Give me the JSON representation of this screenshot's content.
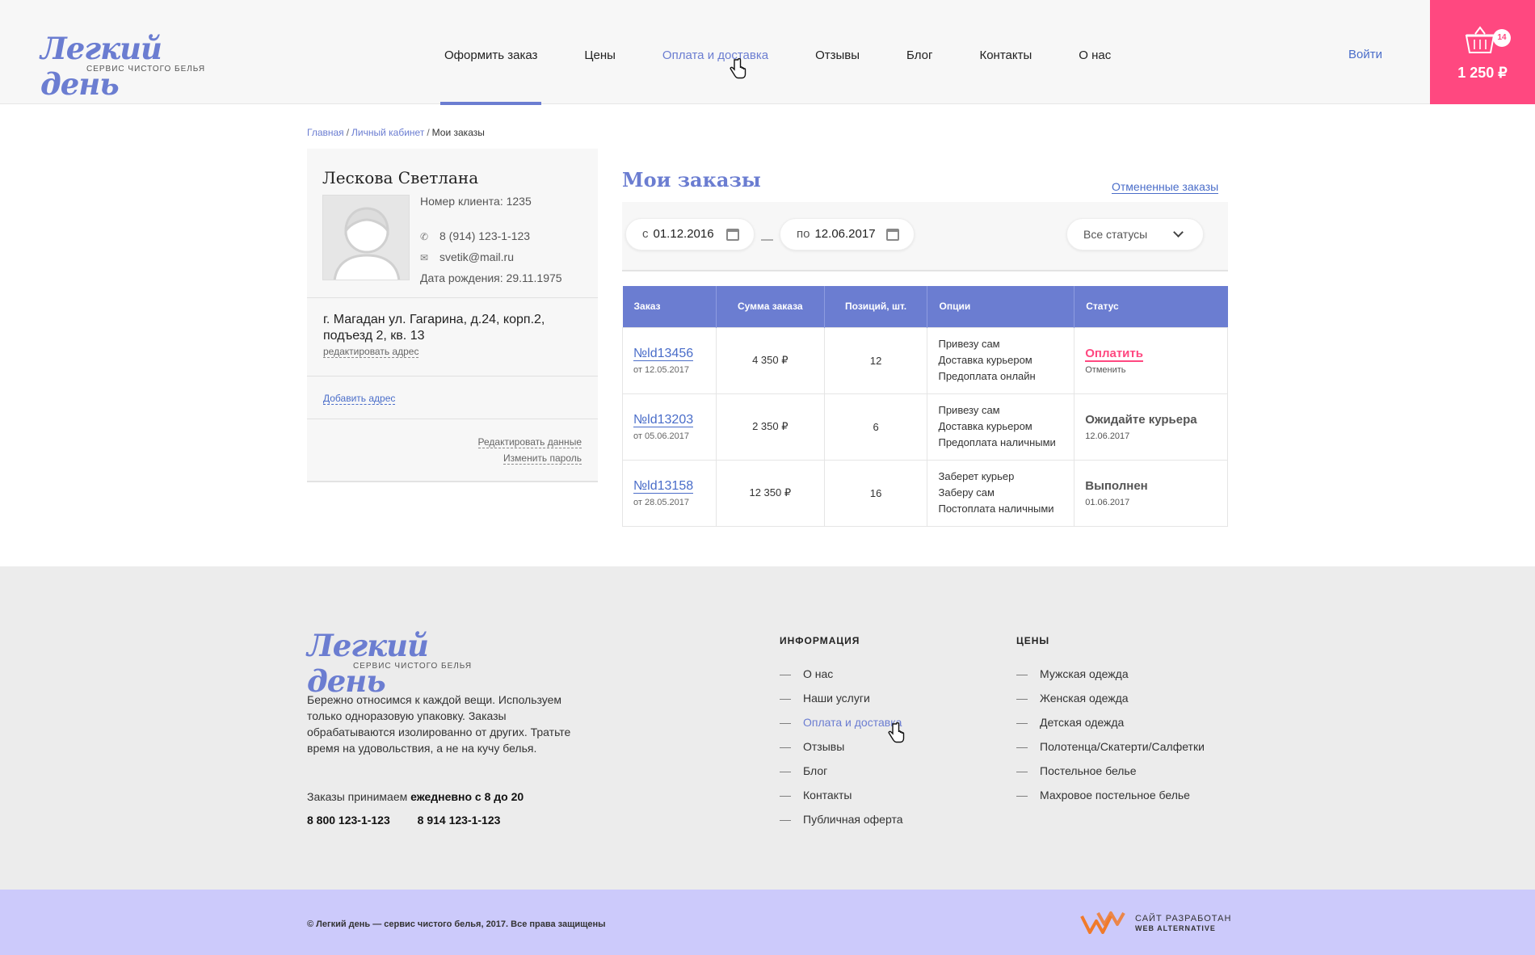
{
  "brand": {
    "name": "Легкий день",
    "tagline": "сервис чистого белья"
  },
  "nav": [
    {
      "label": "Оформить заказ",
      "active": true
    },
    {
      "label": "Цены"
    },
    {
      "label": "Оплата и доставка",
      "hover": true
    },
    {
      "label": "Отзывы"
    },
    {
      "label": "Блог"
    },
    {
      "label": "Контакты"
    },
    {
      "label": "О нас"
    }
  ],
  "header": {
    "login_label": "Войти",
    "cart_count": "14",
    "cart_total": "1 250 ₽"
  },
  "breadcrumb": {
    "home": "Главная",
    "cabinet": "Личный кабинет",
    "current": "Мои заказы",
    "separator": "/"
  },
  "profile": {
    "name": "Лескова Светлана",
    "client_number": "Номер клиента: 1235",
    "phone": "8 (914) 123-1-123",
    "email": "svetik@mail.ru",
    "birthdate": "Дата рождения: 29.11.1975",
    "address": "г. Магадан ул. Гагарина, д.24, корп.2, подъезд 2, кв. 13",
    "edit_address": "редактировать адрес",
    "add_address": "Добавить адрес",
    "edit_data": "Редактировать данные",
    "change_password": "Изменить пароль"
  },
  "orders": {
    "title": "Мои заказы",
    "cancelled_link": "Отмененные заказы",
    "filter": {
      "from_prefix": "с",
      "from_date": "01.12.2016",
      "dash": "—",
      "to_prefix": "по",
      "to_date": "12.06.2017",
      "status_select": "Все статусы"
    },
    "columns": [
      "Заказ",
      "Сумма заказа",
      "Позиций, шт.",
      "Опции",
      "Статус"
    ],
    "rows": [
      {
        "id": "№ld13456",
        "date": "от 12.05.2017",
        "sum": "4 350 ₽",
        "qty": "12",
        "options": [
          "Привезу сам",
          "Доставка курьером",
          "Предоплата онлайн"
        ],
        "status": "Оплатить",
        "status_sub": "Отменить"
      },
      {
        "id": "№ld13203",
        "date": "от 05.06.2017",
        "sum": "2 350 ₽",
        "qty": "6",
        "options": [
          "Привезу сам",
          "Доставка курьером",
          "Предоплата наличными"
        ],
        "status": "Ожидайте курьера",
        "status_sub": "12.06.2017"
      },
      {
        "id": "№ld13158",
        "date": "от 28.05.2017",
        "sum": "12 350 ₽",
        "qty": "16",
        "options": [
          "Заберет курьер",
          "Заберу сам",
          "Постоплата наличными"
        ],
        "status": "Выполнен",
        "status_sub": "01.06.2017"
      }
    ]
  },
  "footer": {
    "about": "Бережно относимся к каждой вещи. Используем только одноразовую упаковку.  Заказы обрабатываются изолированно от других. Тратьте время на удовольствия, а не на кучу белья.",
    "hours_prefix": "Заказы  принимаем",
    "hours_bold": "ежедневно с 8 до 20",
    "phone1": "8 800 123-1-123",
    "phone2": "8 914  123-1-123",
    "info_title": "Информация",
    "info_links": [
      "О нас",
      "Наши услуги",
      "Оплата и доставка",
      "Отзывы",
      "Блог",
      "Контакты",
      "Публичная оферта"
    ],
    "prices_title": "Цены",
    "prices_links": [
      "Мужская одежда",
      "Женская одежда",
      "Детская одежда",
      "Полотенца/Скатерти/Салфетки",
      "Постельное белье",
      "Махровое постельное белье"
    ],
    "copyright": "© Легкий день — сервис чистого белья, 2017. Все права защищены",
    "dev_line1": "САЙТ РАЗРАБОТАН",
    "dev_line2": "WEB ALTERNATIVE"
  },
  "colors": {
    "accent": "#6b7dd1",
    "link": "#4a6dc9",
    "cart": "#ff4880",
    "footer_bar": "#cccafb",
    "dev_logo": "#f07a2a"
  }
}
